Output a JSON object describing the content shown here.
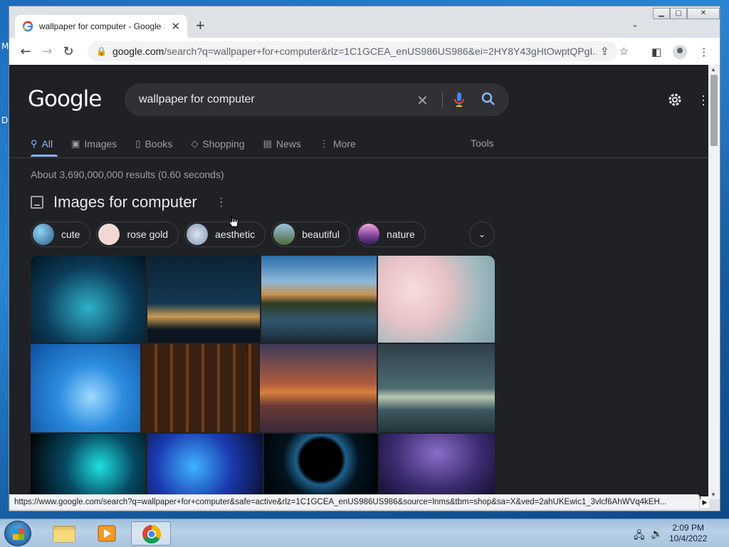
{
  "desktop": {
    "glyphs": [
      "M",
      "D"
    ]
  },
  "browser": {
    "tab_title": "wallpaper for computer - Google Search",
    "new_tab_label": "+",
    "url_host": "google.com",
    "url_path": "/search?q=wallpaper+for+computer&rlz=1C1GCEA_enUS986US986&ei=2HY8Y43gHtOwptQPgI...",
    "status_url": "https://www.google.com/search?q=wallpaper+for+computer&safe=active&rlz=1C1GCEA_enUS986US986&source=lnms&tbm=shop&sa=X&ved=2ahUKEwic1_3vlcf6AhWVq4kEH..."
  },
  "google": {
    "logo": "Google",
    "query": "wallpaper for computer",
    "nav_tabs": [
      {
        "label": "All",
        "icon": "search-icon",
        "active": true
      },
      {
        "label": "Images",
        "icon": "image-icon"
      },
      {
        "label": "Books",
        "icon": "book-icon"
      },
      {
        "label": "Shopping",
        "icon": "tag-icon"
      },
      {
        "label": "News",
        "icon": "news-icon"
      },
      {
        "label": "More",
        "icon": "kebab-icon"
      }
    ],
    "tools_label": "Tools",
    "result_stats": "About 3,690,000,000 results (0.60 seconds)",
    "images_heading": "Images for computer",
    "chips": [
      {
        "label": "cute",
        "color": "#3f7fa6"
      },
      {
        "label": "rose gold",
        "color": "#f3d9d6"
      },
      {
        "label": "aesthetic",
        "color": "#9fb4c8"
      },
      {
        "label": "beautiful",
        "color": "#6b8a5e"
      },
      {
        "label": "nature",
        "color": "#b06ab3"
      }
    ],
    "image_grid": {
      "row1": [
        "blue cave",
        "night city skyline",
        "mountain lake reflection",
        "cherry blossom"
      ],
      "row2": [
        "windows broken glass",
        "library bookshelves",
        "sunset over sea",
        "ocean horizon quote"
      ],
      "row3": [
        "neon wolf",
        "blue abstract",
        "planet eclipse",
        "purple night sky"
      ]
    }
  },
  "taskbar": {
    "time": "2:09 PM",
    "date": "10/4/2022"
  }
}
